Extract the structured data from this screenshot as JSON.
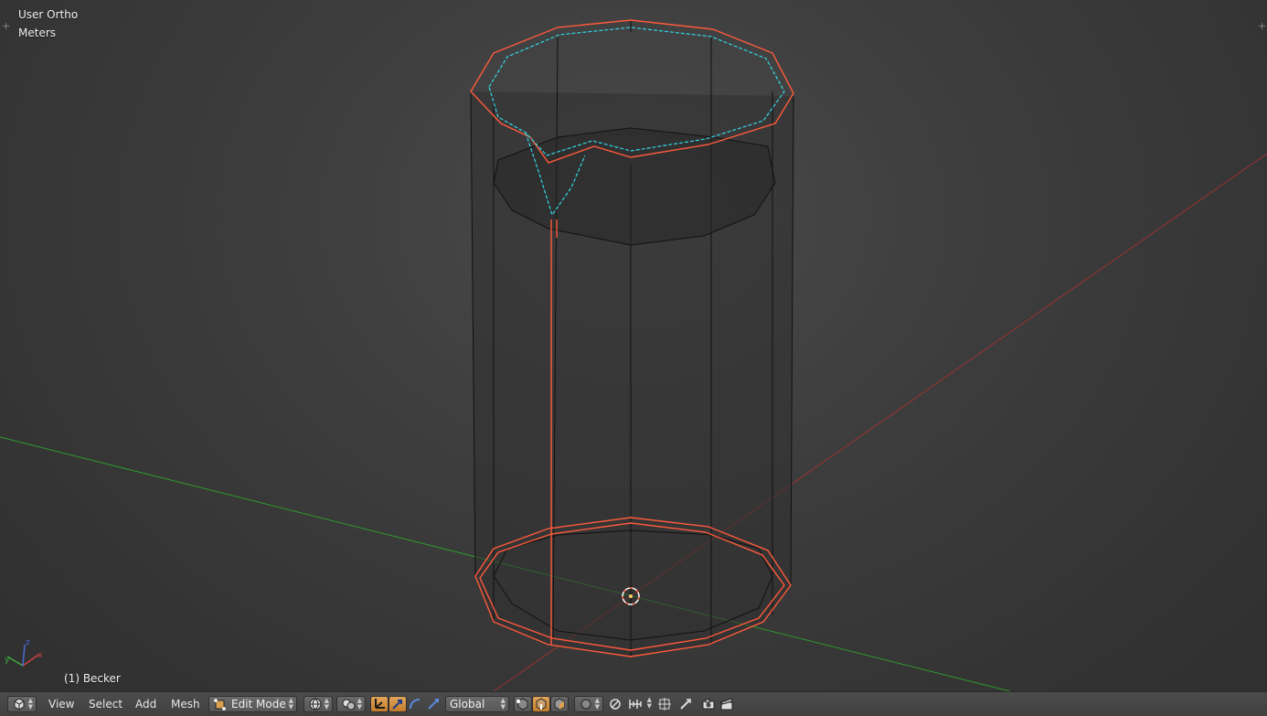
{
  "viewport": {
    "view_label": "User Ortho",
    "units_label": "Meters",
    "object_label": "(1) Becker",
    "axis_labels": {
      "x": "x",
      "y": "y",
      "z": "z"
    }
  },
  "colors": {
    "mesh_edge": "#000000",
    "selected_edge": "#ff5a3c",
    "seam": "#33d6e6",
    "x_axis": "#b03a3a",
    "y_axis": "#3fae3f",
    "header_bg": "#454545"
  },
  "header": {
    "editor_type_icon": "cube-icon",
    "menus": [
      "View",
      "Select",
      "Add",
      "Mesh"
    ],
    "mode": "Edit Mode",
    "pivot_icon": "globe-icon",
    "transform_orientation": "Global",
    "select_modes": [
      "vertex-select-icon",
      "edge-select-icon",
      "face-select-icon"
    ],
    "manipulator_icons": [
      "translate-icon",
      "rotate-icon",
      "scale-icon"
    ],
    "proportional_icon": "proportional-edit-icon",
    "snap_icons": [
      "magnet-icon",
      "snap-increment-icon",
      "snap-target-icon"
    ],
    "render_icons": [
      "camera-render-icon",
      "clapper-render-icon"
    ]
  }
}
